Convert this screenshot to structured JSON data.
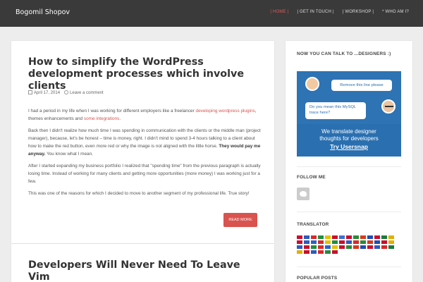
{
  "header": {
    "brand": "Bogomil Shopov",
    "nav": [
      "| HOME |",
      "| GET IN TOUCH |",
      "| WORKSHOP |",
      "* WHO AM I?"
    ]
  },
  "post1": {
    "title": "How to simplify the WordPress development processes which involve clients",
    "date": "April 17, 2014",
    "comment": "Leave a comment",
    "p1_pre": "I had a period in my life when I was working for different employers like a freelancer ",
    "p1_link1": "developing wordpress plugins",
    "p1_mid": ", themes enhancements and ",
    "p1_link2": "some integrations",
    "p1_post": ".",
    "p2": "Back then I didn't realize how much time I was spending in communication with the clients or the middle man (project manager), because, let's be honest – time is money, right. I didn't mind to spend 3-4 hours talking to a client about how to make the red button, even more red or why the image is not aligned with the little horse. ",
    "p2_bold": "They would pay me anyway.",
    "p2_end": " You know what I mean.",
    "p3": "After I started expanding my business portfolio I realized that \"spending time\" from the previous paragraph is actually losing time. Instead of working for many clients and getting more opportunities (more money) I was working just for a few.",
    "p4": "This was one of the reasons for which I decided to move to another segment of my professional life. True story!",
    "read_more": "READ MORE"
  },
  "post2": {
    "title": "Developers Will Never Need To Leave Vim"
  },
  "sidebar": {
    "ad_title": "NOW YOU CAN TALK TO ...DESIGNERS :)",
    "ad_bubble1": "Remove this line please",
    "ad_bubble2": "Do you mean this MySQL trace here?",
    "ad_line1": "We translate designer",
    "ad_line2": "thoughts for developers",
    "ad_cta": "Try Usersnap",
    "follow_title": "FOLLOW ME",
    "translator_title": "TRANSLATOR",
    "popular_title": "POPULAR POSTS"
  },
  "colors": {
    "accent": "#d9534f",
    "topbar": "#3a3a3a",
    "ad_blue": "#2a6fb0"
  },
  "icons": [
    "calendar-icon",
    "comment-icon",
    "twitter-icon",
    "flag-icon"
  ]
}
